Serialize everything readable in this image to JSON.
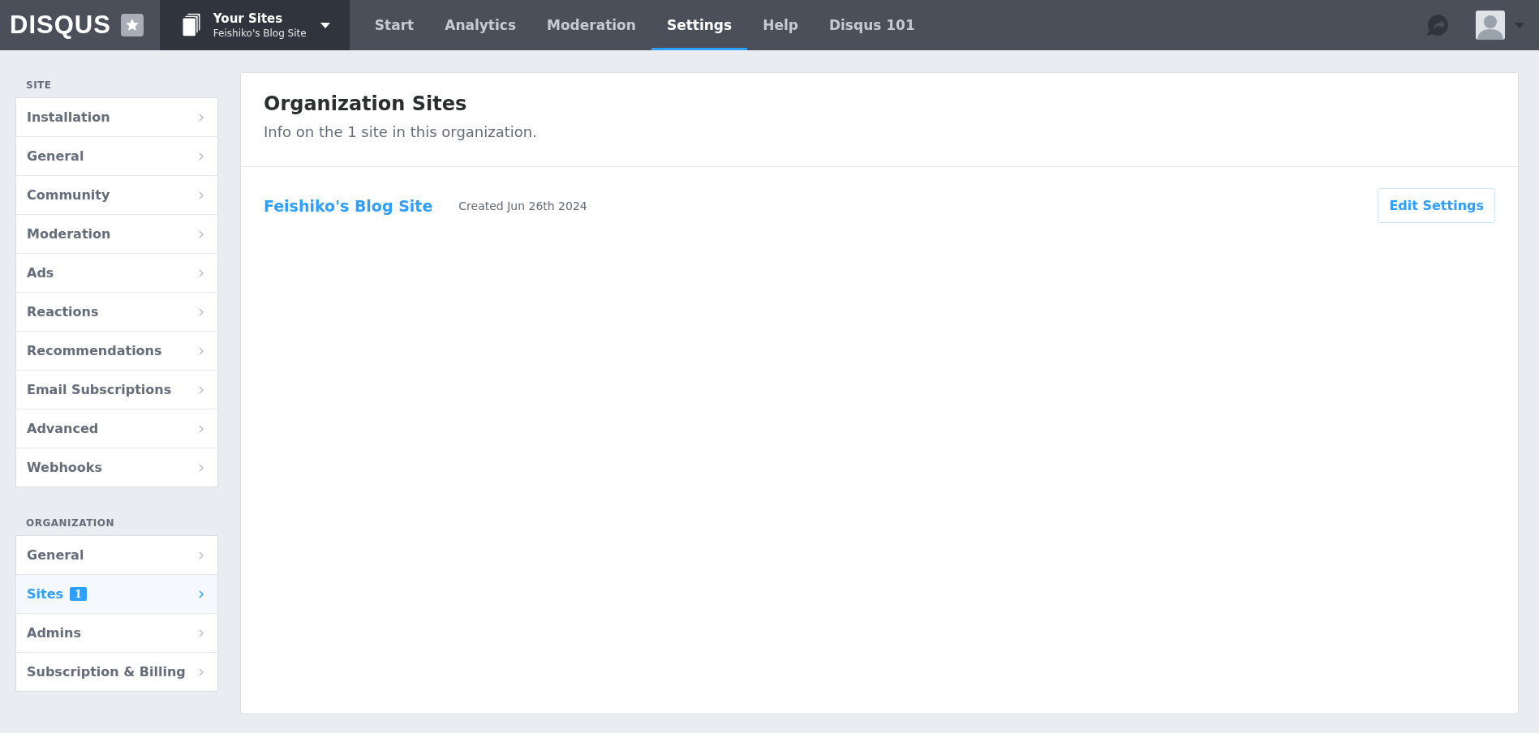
{
  "header": {
    "logo": "DISQUS",
    "site_switcher": {
      "title": "Your Sites",
      "subtitle": "Feishiko's Blog Site"
    },
    "nav": [
      {
        "label": "Start",
        "selected": false
      },
      {
        "label": "Analytics",
        "selected": false
      },
      {
        "label": "Moderation",
        "selected": false
      },
      {
        "label": "Settings",
        "selected": true
      },
      {
        "label": "Help",
        "selected": false
      },
      {
        "label": "Disqus 101",
        "selected": false
      }
    ]
  },
  "sidebar": {
    "sections": [
      {
        "heading": "SITE",
        "items": [
          {
            "label": "Installation",
            "selected": false
          },
          {
            "label": "General",
            "selected": false
          },
          {
            "label": "Community",
            "selected": false
          },
          {
            "label": "Moderation",
            "selected": false
          },
          {
            "label": "Ads",
            "selected": false
          },
          {
            "label": "Reactions",
            "selected": false
          },
          {
            "label": "Recommendations",
            "selected": false
          },
          {
            "label": "Email Subscriptions",
            "selected": false
          },
          {
            "label": "Advanced",
            "selected": false
          },
          {
            "label": "Webhooks",
            "selected": false
          }
        ]
      },
      {
        "heading": "ORGANIZATION",
        "items": [
          {
            "label": "General",
            "selected": false
          },
          {
            "label": "Sites",
            "badge": "1",
            "selected": true
          },
          {
            "label": "Admins",
            "selected": false
          },
          {
            "label": "Subscription & Billing",
            "selected": false
          }
        ]
      }
    ]
  },
  "main": {
    "title": "Organization Sites",
    "subtitle": "Info on the 1 site in this organization.",
    "sites": [
      {
        "name": "Feishiko's Blog Site",
        "created": "Created Jun 26th 2024",
        "button": "Edit Settings"
      }
    ]
  }
}
